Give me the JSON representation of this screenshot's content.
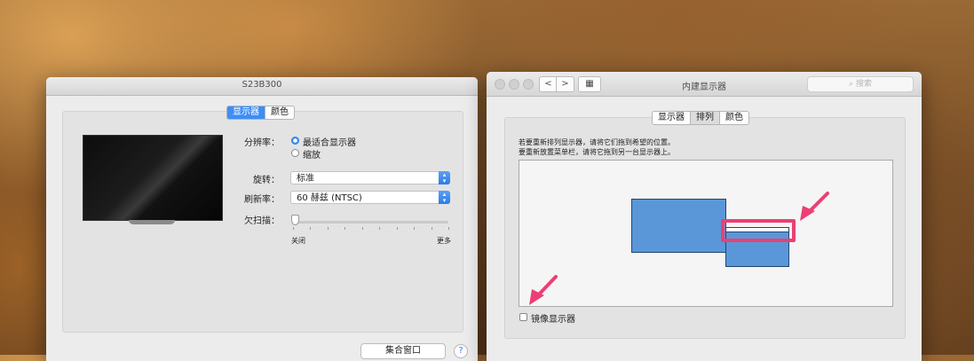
{
  "left_window": {
    "title": "S23B300",
    "tabs": [
      {
        "label": "显示器",
        "active": true
      },
      {
        "label": "颜色",
        "active": false
      }
    ],
    "resolution": {
      "label": "分辨率：",
      "options": [
        {
          "label": "最适合显示器",
          "selected": true
        },
        {
          "label": "缩放",
          "selected": false
        }
      ]
    },
    "rotation": {
      "label": "旋转：",
      "value": "标准"
    },
    "refresh": {
      "label": "刷新率：",
      "value": "60 赫兹 (NTSC)"
    },
    "underscan": {
      "label": "欠扫描：",
      "min_label": "关闭",
      "max_label": "更多",
      "level": 0
    },
    "gather_button": "集合窗口",
    "help": "?"
  },
  "right_window": {
    "title": "内建显示器",
    "nav_back": "<",
    "nav_forward": ">",
    "grid_icon": "grid-icon",
    "search_placeholder": "搜索",
    "tabs": [
      {
        "label": "显示器",
        "active": false
      },
      {
        "label": "排列",
        "active": true
      },
      {
        "label": "颜色",
        "active": false
      }
    ],
    "hint_line1": "若要重新排列显示器，请将它们拖到希望的位置。",
    "hint_line2": "要重新放置菜单栏，请将它拖到另一台显示器上。",
    "mirror_label": "镜像显示器",
    "mirror_checked": false
  },
  "colors": {
    "accent": "#3d8ef7",
    "display_fill": "#5a97d8",
    "annotation": "#ec3f73"
  }
}
